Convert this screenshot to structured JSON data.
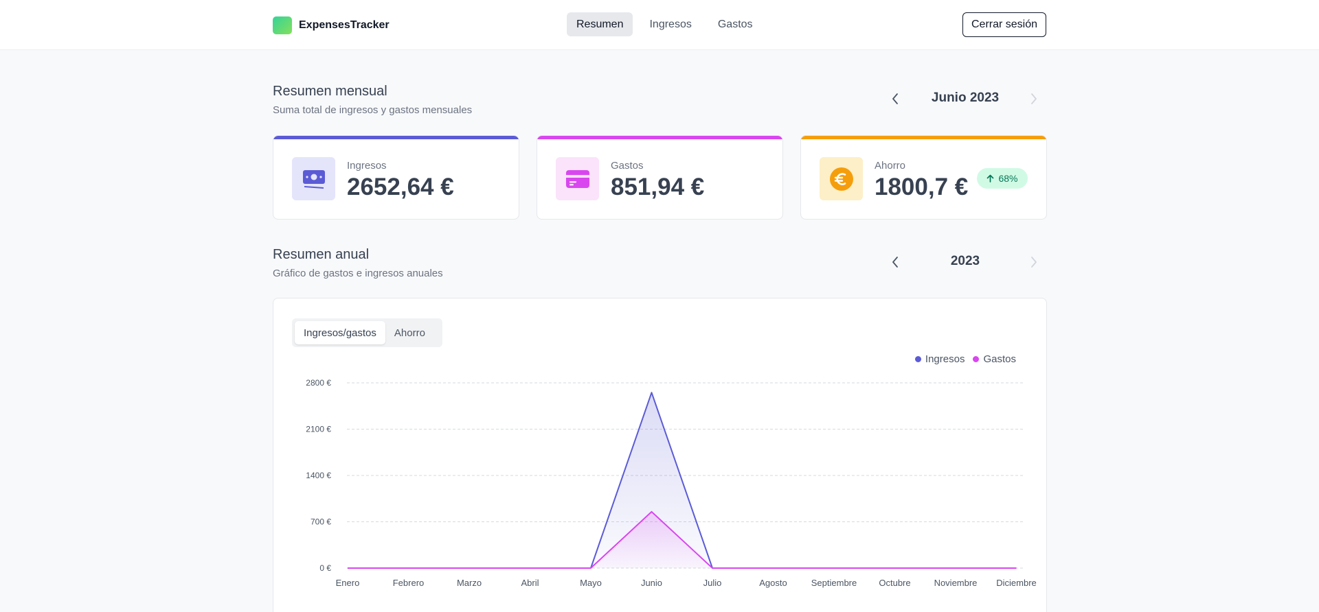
{
  "app": {
    "name": "ExpensesTracker"
  },
  "nav": {
    "items": [
      "Resumen",
      "Ingresos",
      "Gastos"
    ],
    "active": "Resumen"
  },
  "header": {
    "logout_label": "Cerrar sesión"
  },
  "monthly": {
    "title": "Resumen mensual",
    "subtitle": "Suma total de ingresos y gastos mensuales",
    "period": "Junio 2023",
    "prev_icon": "chevron-left-icon",
    "next_icon": "chevron-right-icon"
  },
  "cards": [
    {
      "label": "Ingresos",
      "value": "2652,64 €",
      "icon": "banknote-icon",
      "accent": "#5b5bd6",
      "icon_bg": "#e4e5fb"
    },
    {
      "label": "Gastos",
      "value": "851,94 €",
      "icon": "credit-card-icon",
      "accent": "#d946ef",
      "icon_bg": "#fbe3fb"
    },
    {
      "label": "Ahorro",
      "value": "1800,7 €",
      "icon": "euro-icon",
      "accent": "#f59e0b",
      "icon_bg": "#fdefc7",
      "badge": "68%"
    }
  ],
  "annual": {
    "title": "Resumen anual",
    "subtitle": "Gráfico de gastos e ingresos anuales",
    "period": "2023"
  },
  "chart_tabs": {
    "items": [
      "Ingresos/gastos",
      "Ahorro"
    ],
    "active": "Ingresos/gastos"
  },
  "chart_data": {
    "type": "area",
    "categories": [
      "Enero",
      "Febrero",
      "Marzo",
      "Abril",
      "Mayo",
      "Junio",
      "Julio",
      "Agosto",
      "Septiembre",
      "Octubre",
      "Noviembre",
      "Diciembre"
    ],
    "series": [
      {
        "name": "Ingresos",
        "color": "#5b5bd6",
        "values": [
          0,
          0,
          0,
          0,
          0,
          2652.64,
          0,
          0,
          0,
          0,
          0,
          0
        ]
      },
      {
        "name": "Gastos",
        "color": "#d946ef",
        "values": [
          0,
          0,
          0,
          0,
          0,
          851.94,
          0,
          0,
          0,
          0,
          0,
          0
        ]
      }
    ],
    "ylim": [
      0,
      2800
    ],
    "yticks": [
      0,
      700,
      1400,
      2100,
      2800
    ],
    "ytick_labels": [
      "0 €",
      "700 €",
      "1400 €",
      "2100 €",
      "2800 €"
    ],
    "grid": true,
    "legend_position": "top-right"
  }
}
